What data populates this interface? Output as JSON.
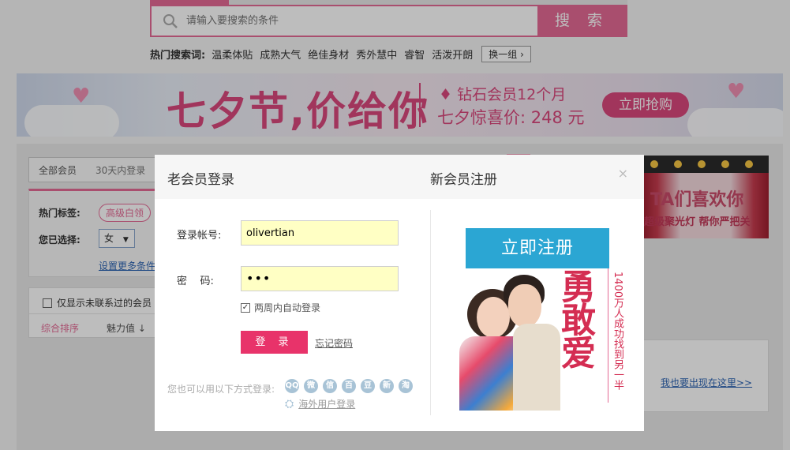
{
  "search": {
    "placeholder": "请输入要搜索的条件",
    "button": "搜 索"
  },
  "hot": {
    "title": "热门搜索词:",
    "items": [
      "温柔体贴",
      "成熟大气",
      "绝佳身材",
      "秀外慧中",
      "睿智",
      "活泼开朗"
    ],
    "change": "换一组 ›"
  },
  "banner": {
    "title": "七夕节,价给你",
    "vip": "钻石会员12个月",
    "price": "七夕惊喜价: 248 元",
    "button": "立即抢购"
  },
  "breadcrumb": {
    "all": "全部会员",
    "recent": "30天内登录"
  },
  "filter": {
    "hot_label": "热门标签:",
    "tag": "高级白领",
    "chosen_label": "您已选择:",
    "gender": "女",
    "more": "设置更多条件"
  },
  "list": {
    "only_uncontacted": "仅显示未联系过的会员",
    "sort_all": "综合排序",
    "sort_charm": "魅力值 ↓"
  },
  "right_ad": {
    "title": "TA们喜欢你",
    "subtitle": "超级聚光灯 帮你严把关"
  },
  "right_box": {
    "link": "我也要出现在这里>>"
  },
  "modal": {
    "tab_login": "老会员登录",
    "tab_register": "新会员注册",
    "close": "×",
    "account_label": "登录帐号:",
    "account_value": "olivertian",
    "password_label": "密    码:",
    "password_value": "•••",
    "auto_login": "两周内自动登录",
    "login_button": "登 录",
    "forgot": "忘记密码",
    "other_login": "您也可以用以下方式登录:",
    "social": [
      "QQ",
      "微",
      "信",
      "百",
      "豆",
      "新",
      "淘"
    ],
    "overseas": "海外用户登录",
    "register_button": "立即注册",
    "slogan": "勇敢爱",
    "slogan_sub": "1400万人成功找到另一半"
  },
  "colors": {
    "pink": "#e46a95",
    "login_btn": "#e8336a",
    "register_btn": "#2ba6d3",
    "field_bg": "#ffffc4"
  }
}
